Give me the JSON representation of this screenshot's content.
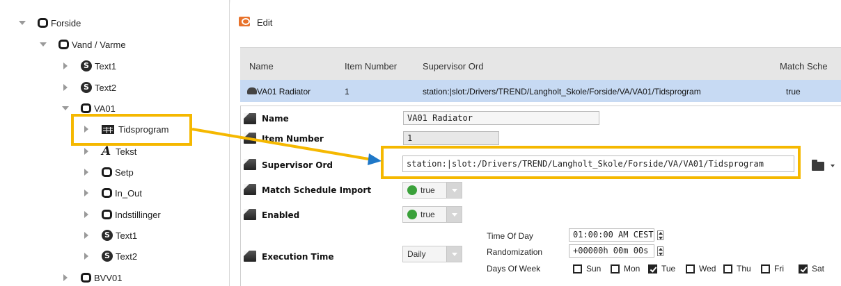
{
  "tree": {
    "items": [
      {
        "label": "Forside",
        "expander": "down",
        "icon": "folder-icon"
      },
      {
        "label": "Vand / Varme",
        "expander": "down",
        "icon": "folder-icon"
      },
      {
        "label": "Text1",
        "expander": "right",
        "icon": "s-badge-icon"
      },
      {
        "label": "Text2",
        "expander": "right",
        "icon": "s-badge-icon"
      },
      {
        "label": "VA01",
        "expander": "down",
        "icon": "folder-icon"
      },
      {
        "label": "Tidsprogram",
        "expander": "right",
        "icon": "schedule-grid-icon"
      },
      {
        "label": "Tekst",
        "expander": "right",
        "icon": "text-a-icon"
      },
      {
        "label": "Setp",
        "expander": "right",
        "icon": "folder-icon"
      },
      {
        "label": "In_Out",
        "expander": "right",
        "icon": "folder-icon"
      },
      {
        "label": "Indstillinger",
        "expander": "right",
        "icon": "folder-icon"
      },
      {
        "label": "Text1",
        "expander": "right",
        "icon": "s-badge-icon"
      },
      {
        "label": "Text2",
        "expander": "right",
        "icon": "s-badge-icon"
      },
      {
        "label": "BVV01",
        "expander": "right",
        "icon": "folder-icon"
      }
    ]
  },
  "edit": {
    "title": "Edit",
    "columns": [
      "Name",
      "Item Number",
      "Supervisor Ord",
      "Match Sche"
    ],
    "row": {
      "name": "VA01 Radiator",
      "item_number": "1",
      "supervisor_ord": "station:|slot:/Drivers/TREND/Langholt_Skole/Forside/VA/VA01/Tidsprogram",
      "match": "true"
    }
  },
  "properties": {
    "name": {
      "label": "Name",
      "value": "VA01 Radiator"
    },
    "item_number": {
      "label": "Item Number",
      "value": "1"
    },
    "supervisor_ord": {
      "label": "Supervisor Ord",
      "value": "station:|slot:/Drivers/TREND/Langholt_Skole/Forside/VA/VA01/Tidsprogram"
    },
    "match_schedule_import": {
      "label": "Match Schedule Import",
      "value": "true"
    },
    "enabled": {
      "label": "Enabled",
      "value": "true"
    },
    "execution_time": {
      "label": "Execution Time",
      "mode": "Daily",
      "time_of_day_label": "Time Of Day",
      "time_of_day": "01:00:00 AM CEST",
      "randomization_label": "Randomization",
      "randomization": "+00000h 00m 00s",
      "days_label": "Days Of Week",
      "days": [
        {
          "name": "Sun",
          "checked": false
        },
        {
          "name": "Mon",
          "checked": false
        },
        {
          "name": "Tue",
          "checked": true
        },
        {
          "name": "Wed",
          "checked": false
        },
        {
          "name": "Thu",
          "checked": false
        },
        {
          "name": "Fri",
          "checked": false
        },
        {
          "name": "Sat",
          "checked": true
        }
      ]
    }
  },
  "colors": {
    "highlight": "#f5b800",
    "selected_row": "#c7daf3",
    "bool_true": "#3aa13a"
  }
}
